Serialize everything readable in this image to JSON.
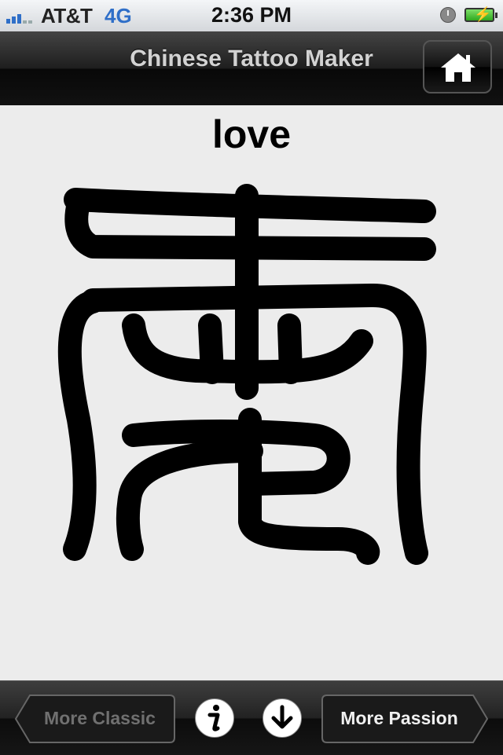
{
  "status_bar": {
    "carrier": "AT&T",
    "network": "4G",
    "time": "2:36 PM",
    "icons": [
      "signal-bars-icon",
      "alarm-clock-icon",
      "battery-charging-icon"
    ]
  },
  "nav_bar": {
    "title": "Chinese Tattoo Maker",
    "home_icon": "home-icon"
  },
  "content": {
    "word": "love",
    "glyph": "seal-script-character-icon"
  },
  "toolbar": {
    "prev_label": "More Classic",
    "next_label": "More Passion",
    "info_icon": "info-icon",
    "download_icon": "download-icon"
  },
  "colors": {
    "accent_blue": "#2f6fc8",
    "nav_bar": "#111111",
    "content_bg": "#ececec",
    "glyph": "#000000"
  }
}
